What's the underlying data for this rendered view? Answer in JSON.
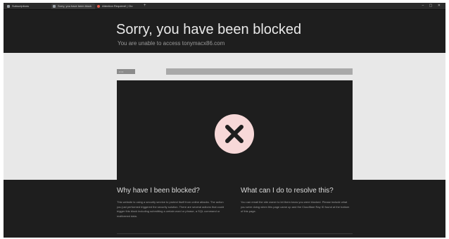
{
  "browser": {
    "tabs": [
      {
        "label": "Subscriptions",
        "active": false
      },
      {
        "label": "Sorry, you have been block",
        "active": true
      },
      {
        "label": "Attention Required! | Clo",
        "active": false
      }
    ],
    "new_tab_glyph": "+",
    "window_controls": "– ▢ ✕"
  },
  "page": {
    "title": "Sorry, you have been blocked",
    "subtitle": "You are unable to access tonymacx86.com",
    "mock_dots": "•••",
    "status_icon": "x-circle-icon",
    "colors": {
      "background": "#1e1e1e",
      "band": "#e8e8e8",
      "badge": "#f7d8d8"
    }
  },
  "sections": {
    "why": {
      "heading": "Why have I been blocked?",
      "body": "This website is using a security service to protect itself from online attacks. The action you just performed triggered the security solution. There are several actions that could trigger this block including submitting a certain word or phrase, a SQL command or malformed data."
    },
    "resolve": {
      "heading": "What can I do to resolve this?",
      "body": "You can email the site owner to let them know you were blocked. Please include what you were doing when this page came up and the Cloudflare Ray ID found at the bottom of this page."
    }
  }
}
